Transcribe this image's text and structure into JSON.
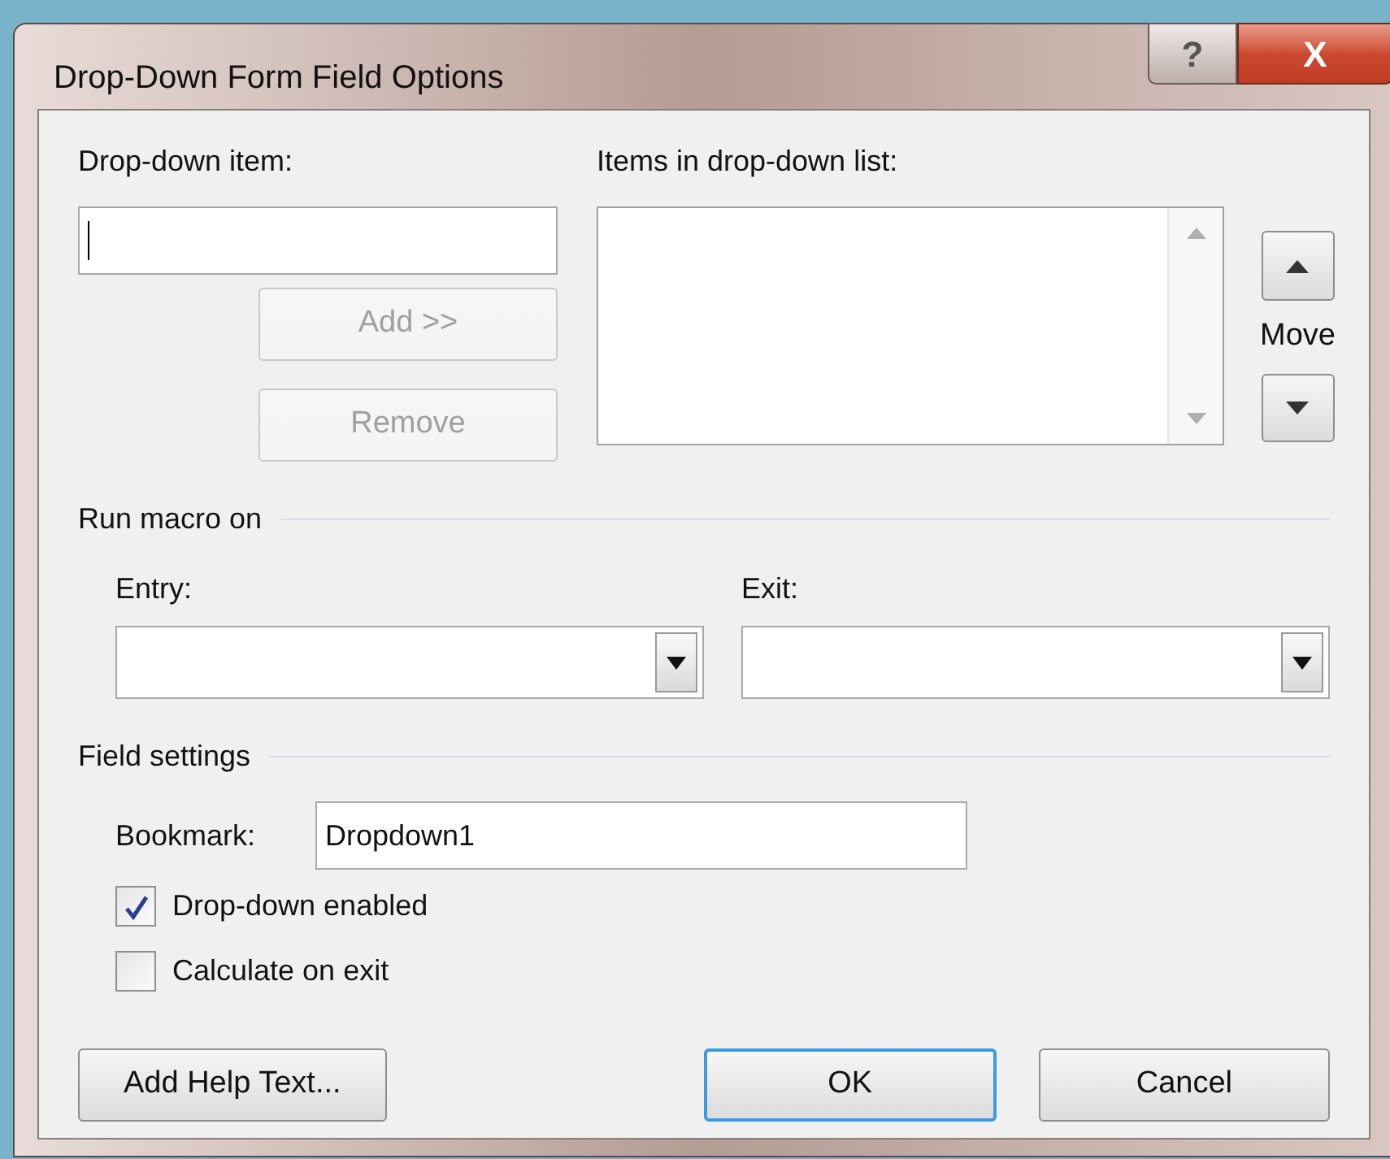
{
  "window": {
    "title": "Drop-Down Form Field Options",
    "help_button": "?",
    "close_button": "X"
  },
  "drop_down_item": {
    "label": "Drop-down item:"
  },
  "items_list": {
    "label": "Items in drop-down list:"
  },
  "list_buttons": [
    {
      "label": "Add >>",
      "disabled": true
    },
    {
      "label": "Remove",
      "disabled": true
    }
  ],
  "move": {
    "label": "Move"
  },
  "run_macro_on": {
    "heading": "Run macro on",
    "entry_label": "Entry:",
    "exit_label": "Exit:"
  },
  "field_settings": {
    "heading": "Field settings",
    "bookmark_label": "Bookmark:",
    "bookmark_value": "Dropdown1",
    "checkboxes": [
      {
        "label": "Drop-down enabled",
        "checked": true
      },
      {
        "label": "Calculate on exit",
        "checked": false
      }
    ]
  },
  "buttons": [
    {
      "label": "Add Help Text...",
      "default": false
    },
    {
      "label": "OK",
      "default": true
    },
    {
      "label": "Cancel",
      "default": false
    }
  ]
}
